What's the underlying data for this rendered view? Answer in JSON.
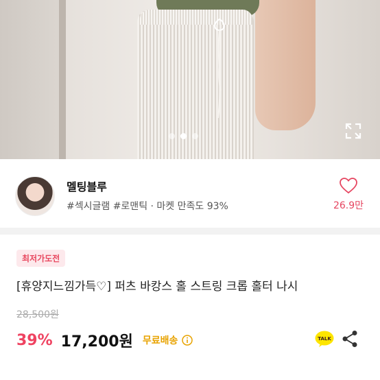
{
  "gallery": {
    "image_count": 3,
    "active_index": 1,
    "expand_icon": "expand-icon"
  },
  "seller": {
    "name": "멜팅블루",
    "tags": "#섹시글램 #로맨틱 · 마켓 만족도 93%",
    "likes": "26.9만",
    "like_icon": "heart-icon"
  },
  "product": {
    "badge": "최저가도전",
    "title": "[휴양지느낌가득♡] 퍼츠 바캉스 홀 스트링 크롭 홀터 나시",
    "original_price": "28,500원",
    "discount": "39%",
    "price": "17,200원",
    "shipping": "무료배송",
    "talk_label": "TALK"
  },
  "colors": {
    "accent_pink": "#ef4361",
    "shipping_yellow": "#e8a300",
    "kakao_yellow": "#fee500"
  }
}
